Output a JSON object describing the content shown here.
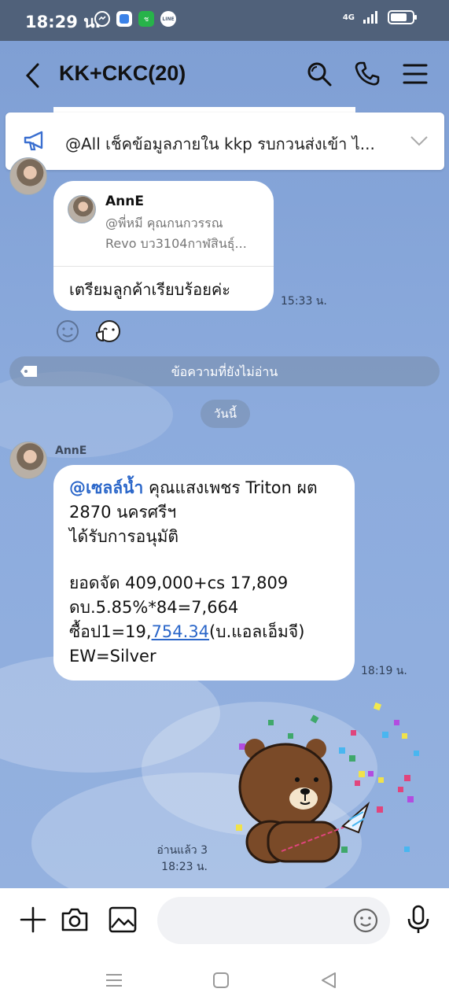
{
  "status": {
    "time": "18:29 น.",
    "network": "4G",
    "app_icons": [
      "messenger-icon",
      "file-icon",
      "app-icon",
      "line-icon"
    ]
  },
  "header": {
    "title": "KK+CKC(20)",
    "icons": [
      "back-icon",
      "search-icon",
      "phone-icon",
      "menu-icon"
    ]
  },
  "announcement": {
    "text": "@All  เช็คข้อมูลภายใน kkp รบกวนส่งเข้า ไ..."
  },
  "messages": [
    {
      "reply": {
        "name": "AnnE",
        "line1": "@พี่หมี คุณกนกวรรณ",
        "line2": "Revo บว3104กาฬสินธุ์..."
      },
      "text": "เตรียมลูกค้าเรียบร้อยค่ะ",
      "time": "15:33 น."
    },
    {
      "sender": "AnnE",
      "mention": "@เซลล์น้ำ",
      "line1_rest": " คุณแสงเพชร Triton ผต",
      "line2": "2870 นครศรีฯ",
      "line3": "ได้รับการอนุมัติ",
      "line4": "ยอดจัด 409,000+cs 17,809",
      "line5": "ดบ.5.85%*84=7,664",
      "line6_pre": "ซื้อป1=19,",
      "line6_link": "754.34",
      "line6_post": "(บ.แอลเอ็มจี)",
      "line7": "EW=Silver",
      "time": "18:19 น."
    }
  ],
  "unread_label": "ข้อความที่ยังไม่อ่าน",
  "date_label": "วันนี้",
  "sticker": {
    "read": "อ่านแล้ว 3",
    "time": "18:23 น.",
    "icon": "brown-bear-sticker"
  },
  "input": {
    "placeholder": "",
    "icons": [
      "plus-icon",
      "camera-icon",
      "image-icon",
      "emoji-icon",
      "mic-icon"
    ]
  },
  "colors": {
    "statusbar": "#50617a",
    "chat_background": "#8aa8db",
    "mention": "#2a66c9"
  }
}
